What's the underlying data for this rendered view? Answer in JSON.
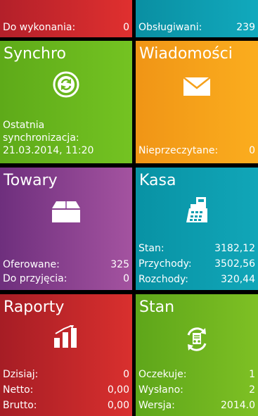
{
  "top": {
    "left": {
      "label": "Do wykonania:",
      "value": "0"
    },
    "right": {
      "label": "Obsługiwani:",
      "value": "239"
    }
  },
  "tiles": {
    "synchro": {
      "title": "Synchro",
      "icon": "sync-icon",
      "lines": [
        "Ostatnia",
        "synchronizacja:",
        "21.03.2014, 11:20"
      ]
    },
    "wiadomosci": {
      "title": "Wiadomości",
      "icon": "envelope-icon",
      "rows": [
        {
          "label": "Nieprzeczytane:",
          "value": "0"
        }
      ]
    },
    "towary": {
      "title": "Towary",
      "icon": "box-icon",
      "rows": [
        {
          "label": "Oferowane:",
          "value": "325"
        },
        {
          "label": "Do przyjęcia:",
          "value": "0"
        }
      ]
    },
    "kasa": {
      "title": "Kasa",
      "icon": "cash-register-icon",
      "rows": [
        {
          "label": "Stan:",
          "value": "3182,12"
        },
        {
          "label": "Przychody:",
          "value": "3502,56"
        },
        {
          "label": "Rozchody:",
          "value": "320,44"
        }
      ]
    },
    "raporty": {
      "title": "Raporty",
      "icon": "bar-chart-icon",
      "rows": [
        {
          "label": "Dzisiaj:",
          "value": "0"
        },
        {
          "label": "Netto:",
          "value": "0,00"
        },
        {
          "label": "Brutto:",
          "value": "0,00"
        }
      ]
    },
    "stan": {
      "title": "Stan",
      "icon": "document-sync-icon",
      "rows": [
        {
          "label": "Oczekuje:",
          "value": "1"
        },
        {
          "label": "Wysłano:",
          "value": "2"
        },
        {
          "label": "Wersja:",
          "value": "2014.0"
        }
      ]
    }
  },
  "colors": {
    "red": "#d9302e",
    "teal": "#11a6b8",
    "green": "#74c322",
    "orange": "#fbad1e",
    "purple": "#a453a0"
  }
}
